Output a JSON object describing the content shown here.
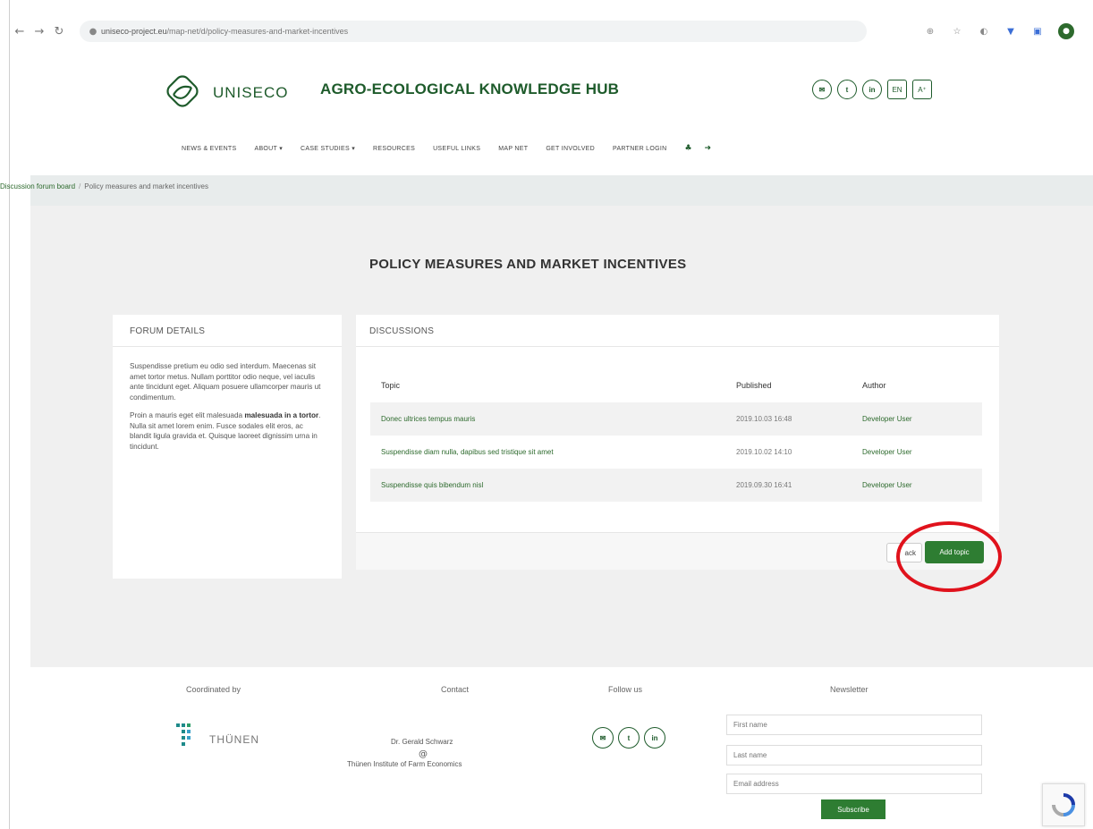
{
  "browser": {
    "url_host": "uniseco-project.eu",
    "url_path": "/map-net/d/policy-measures-and-market-incentives"
  },
  "header": {
    "brand": "UNISECO",
    "title": "AGRO-ECOLOGICAL KNOWLEDGE HUB",
    "social": [
      "✉",
      "t",
      "in"
    ],
    "lang": "EN"
  },
  "menu": {
    "items": [
      "NEWS & EVENTS",
      "ABOUT ▾",
      "CASE STUDIES ▾",
      "RESOURCES",
      "USEFUL LINKS",
      "MAP NET",
      "GET INVOLVED",
      "PARTNER LOGIN"
    ]
  },
  "breadcrumb": {
    "root": "Discussion forum board",
    "separator": "/",
    "current": "Policy measures and market incentives"
  },
  "page": {
    "title": "POLICY MEASURES AND MARKET INCENTIVES"
  },
  "forum_details": {
    "heading": "FORUM DETAILS",
    "para1": "Suspendisse pretium eu odio sed interdum. Maecenas sit amet tortor metus. Nullam porttitor odio neque, vel iaculis ante tincidunt eget. Aliquam posuere ullamcorper mauris ut condimentum.",
    "para2_start": "Proin a mauris eget elit malesuada ",
    "para2_bold": "malesuada in a tortor",
    "para2_end": ". Nulla sit amet lorem enim. Fusce sodales elit eros, ac blandit ligula gravida et. Quisque laoreet dignissim urna in tincidunt."
  },
  "discussions": {
    "heading": "DISCUSSIONS",
    "columns": {
      "topic": "Topic",
      "published": "Published",
      "author": "Author"
    },
    "rows": [
      {
        "topic": "Donec ultrices tempus mauris",
        "published": "2019.10.03 16:48",
        "author": "Developer User"
      },
      {
        "topic": "Suspendisse diam nulla, dapibus sed tristique sit amet",
        "published": "2019.10.02 14:10",
        "author": "Developer User"
      },
      {
        "topic": "Suspendisse quis bibendum nisl",
        "published": "2019.09.30 16:41",
        "author": "Developer User"
      }
    ],
    "back_label": "ack",
    "add_label": "Add topic"
  },
  "footer": {
    "coordinated_by": "Coordinated by",
    "thunen": "THÜNEN",
    "contact_heading": "Contact",
    "contact_name": "Dr. Gerald Schwarz",
    "contact_org": "Thünen Institute of Farm Economics",
    "follow_heading": "Follow us",
    "newsletter_heading": "Newsletter",
    "first_name_placeholder": "First name",
    "last_name_placeholder": "Last name",
    "email_placeholder": "Email address",
    "subscribe_label": "Subscribe"
  },
  "colors": {
    "brand_green": "#1e5b2b",
    "button_green": "#2e7d32",
    "highlight_red": "#e0121c"
  }
}
